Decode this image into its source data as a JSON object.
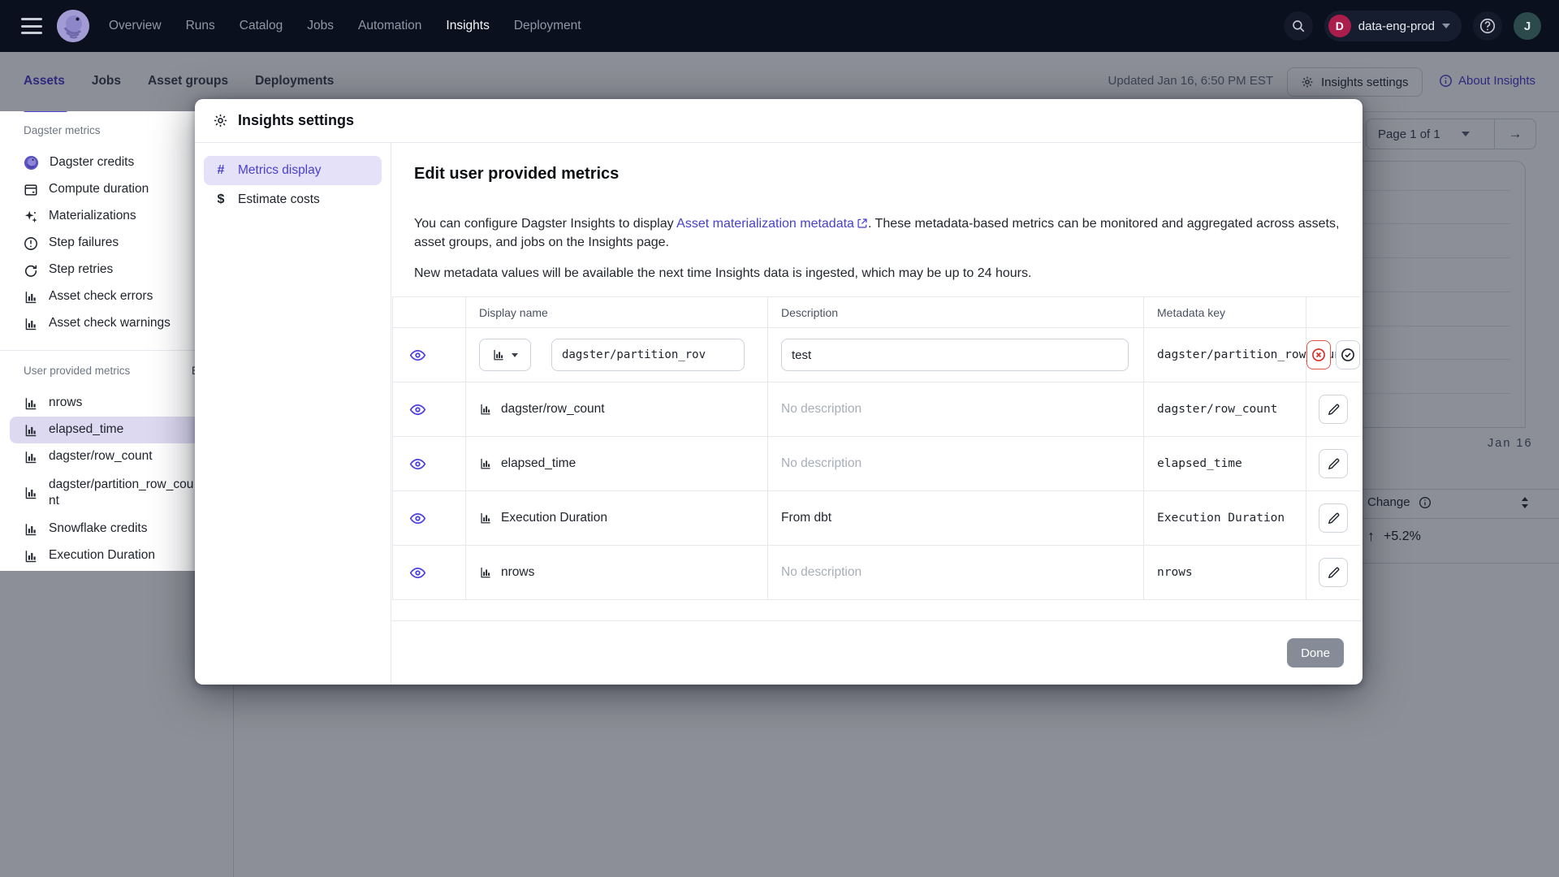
{
  "topnav": {
    "items": [
      "Overview",
      "Runs",
      "Catalog",
      "Jobs",
      "Automation",
      "Insights",
      "Deployment"
    ],
    "active_item": "Insights",
    "deployment": {
      "initial": "D",
      "name": "data-eng-prod"
    },
    "user_initial": "J"
  },
  "tabs_row": {
    "tabs": [
      "Assets",
      "Jobs",
      "Asset groups",
      "Deployments"
    ],
    "active_tab": "Assets",
    "updated": "Updated Jan 16, 6:50 PM EST",
    "settings_button": "Insights settings",
    "about_link": "About Insights"
  },
  "sidebar": {
    "sections": [
      {
        "title": "Dagster metrics",
        "items": [
          {
            "label": "Dagster credits",
            "icon": "dagster-swirl"
          },
          {
            "label": "Compute duration",
            "icon": "window"
          },
          {
            "label": "Materializations",
            "icon": "sparkles"
          },
          {
            "label": "Step failures",
            "icon": "alert-circle"
          },
          {
            "label": "Step retries",
            "icon": "retry"
          },
          {
            "label": "Asset check errors",
            "icon": "bar-chart"
          },
          {
            "label": "Asset check warnings",
            "icon": "bar-chart"
          }
        ]
      },
      {
        "title": "User provided metrics",
        "action": "Edit",
        "items": [
          {
            "label": "nrows",
            "icon": "bar-chart"
          },
          {
            "label": "elapsed_time",
            "icon": "bar-chart",
            "selected": true
          },
          {
            "label": "dagster/row_count",
            "icon": "bar-chart"
          },
          {
            "label": "dagster/partition_row_count",
            "icon": "bar-chart"
          },
          {
            "label": "Snowflake credits",
            "icon": "bar-chart"
          },
          {
            "label": "Execution Duration",
            "icon": "bar-chart"
          }
        ]
      }
    ]
  },
  "modal": {
    "title": "Insights settings",
    "menu": [
      {
        "glyph": "#",
        "label": "Metrics display",
        "selected": true
      },
      {
        "glyph": "$",
        "label": "Estimate costs",
        "selected": false
      }
    ],
    "heading": "Edit user provided metrics",
    "intro_before": "You can configure Dagster Insights to display ",
    "intro_link": "Asset materialization metadata",
    "intro_after": ". These metadata-based metrics can be monitored and aggregated across assets, asset groups, and jobs on the Insights page.",
    "intro_note": "New metadata values will be available the next time Insights data is ingested, which may be up to 24 hours.",
    "table": {
      "headers": [
        "",
        "Display name",
        "Description",
        "Metadata key",
        ""
      ],
      "edit_row": {
        "display_name_value": "dagster/partition_rov",
        "description_value": "test",
        "metadata_key": "dagster/partition_row_count"
      },
      "rows": [
        {
          "display_name": "dagster/row_count",
          "description": "No description",
          "metadata_key": "dagster/row_count"
        },
        {
          "display_name": "elapsed_time",
          "description": "No description",
          "metadata_key": "elapsed_time"
        },
        {
          "display_name": "Execution Duration",
          "description": "From dbt",
          "metadata_key": "Execution Duration"
        },
        {
          "display_name": "nrows",
          "description": "No description",
          "metadata_key": "nrows"
        }
      ]
    },
    "done_button": "Done"
  },
  "background": {
    "pagination_label": "Page 1 of 1",
    "next_arrow": "→",
    "axis_label": "Jan 16",
    "change_label": "Change",
    "change_arrow": "↑",
    "change_value": "+5.2%"
  }
}
